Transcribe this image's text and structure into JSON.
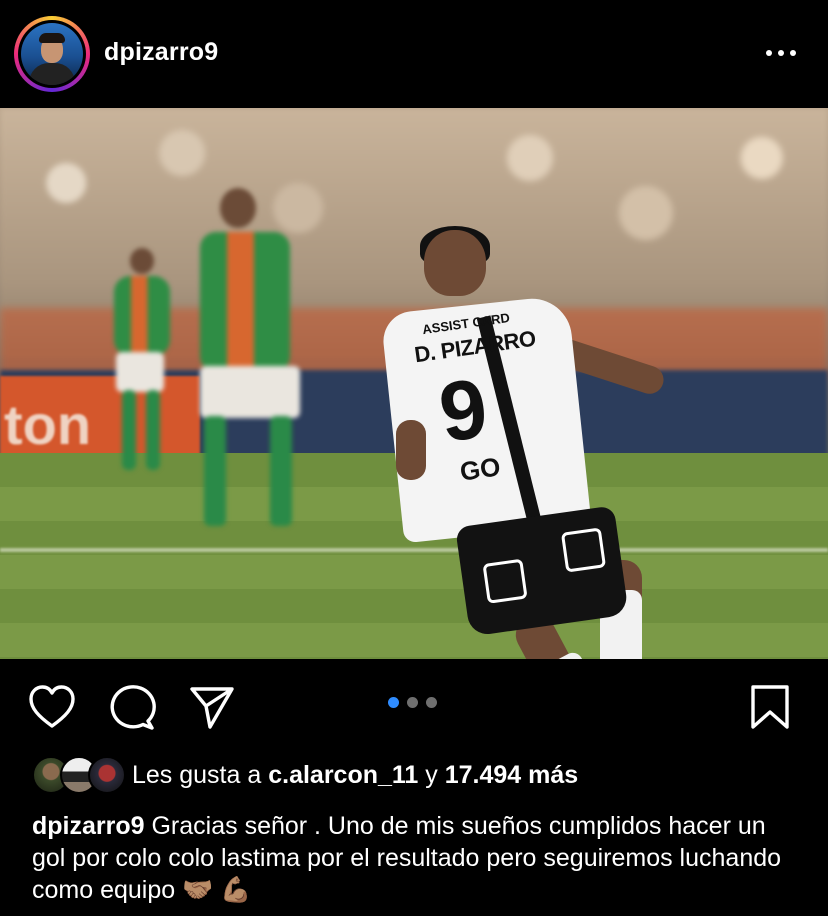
{
  "post": {
    "username": "dpizarro9",
    "more_icon": "more-horizontal-icon"
  },
  "media": {
    "alt_colors": {
      "kit_white": "#f4f4f4",
      "kit_black": "#121212",
      "pitch_green": "#6f8f3e"
    },
    "jersey": {
      "sponsor": "ASSIST CARD",
      "name": "D. PIZARRO",
      "number": "9",
      "chest": "GO"
    },
    "carousel": {
      "count": 3,
      "active_index": 0,
      "active_color": "#2f8cff",
      "inactive_color": "#6f6f6f"
    }
  },
  "actions": {
    "like_icon": "heart-icon",
    "comment_icon": "comment-icon",
    "share_icon": "paper-plane-icon",
    "save_icon": "bookmark-icon"
  },
  "likes": {
    "prefix": "Les gusta a",
    "user": "c.alarcon_11",
    "conjunction": "y",
    "count_text": "17.494 más"
  },
  "caption": {
    "username": "dpizarro9",
    "text": "Gracias señor . Uno de mis sueños cumplidos hacer un gol por colo colo lastima por el resultado pero seguiremos luchando como equipo 🤝🏽 💪🏽"
  }
}
